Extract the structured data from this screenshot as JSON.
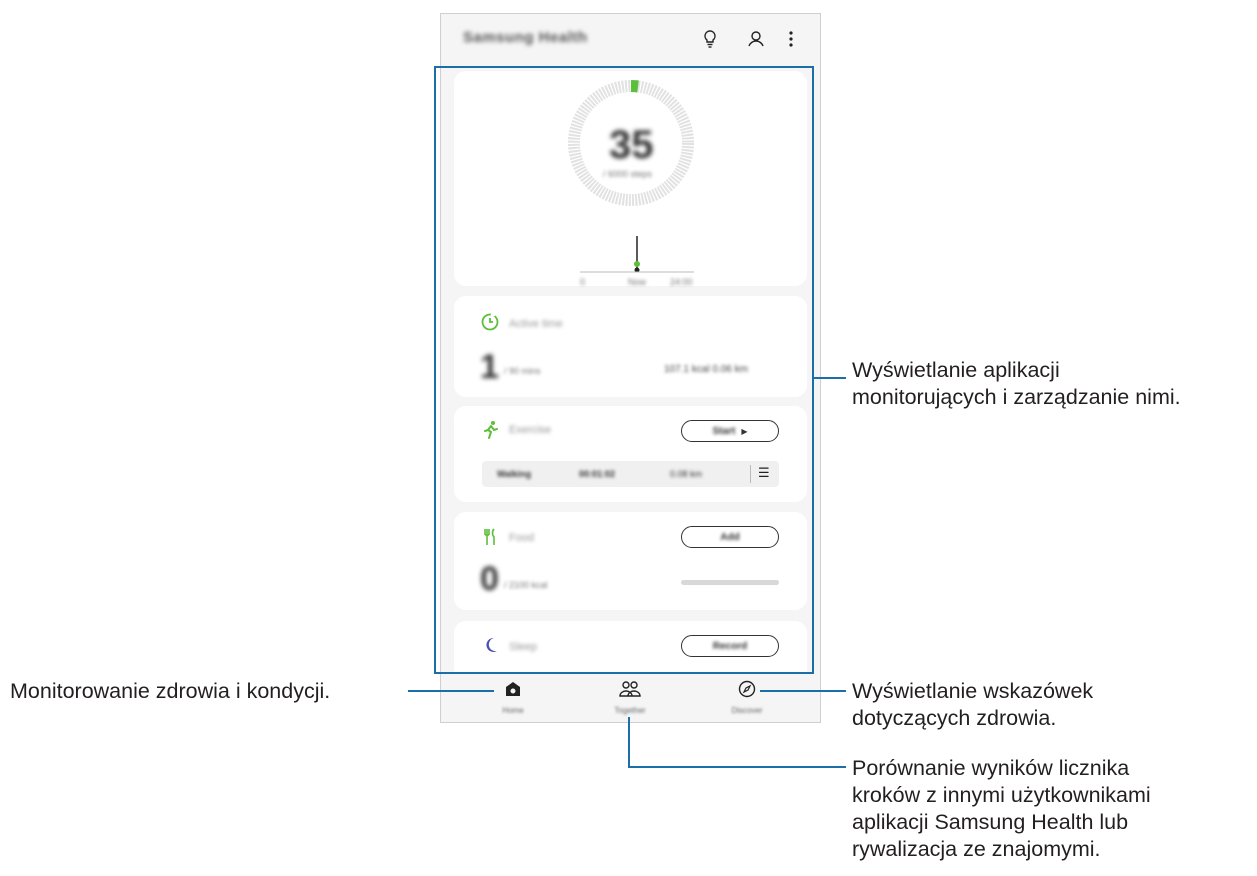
{
  "app": {
    "title": "Samsung Health",
    "icons": [
      "lightbulb-icon",
      "person-icon",
      "more-vertical-icon"
    ]
  },
  "steps_card": {
    "value": "35",
    "target": "/ 6000 steps",
    "chart_labels": [
      "0",
      "Now",
      "24:00"
    ]
  },
  "active_time_card": {
    "title": "Active time",
    "value": "1",
    "unit": "/ 90 mins",
    "detail": "107.1 kcal  0.06 km"
  },
  "exercise_card": {
    "title": "Exercise",
    "button": "Start",
    "last_activity": "Walking",
    "last_time": "00:01:02",
    "last_distance": "0.08 km"
  },
  "food_card": {
    "title": "Food",
    "button": "Add",
    "value": "0",
    "unit": "/ 2100 kcal"
  },
  "sleep_card": {
    "title": "Sleep",
    "button": "Record"
  },
  "nav": {
    "home": "Home",
    "together": "Together",
    "discover": "Discover"
  },
  "callouts": {
    "trackers": [
      "Wyświetlanie aplikacji",
      "monitorujących i zarządzanie nimi."
    ],
    "home": "Monitorowanie zdrowia i kondycji.",
    "discover": [
      "Wyświetlanie wskazówek",
      "dotyczących zdrowia."
    ],
    "together": [
      "Porównanie wyników licznika",
      "kroków z innymi użytkownikami",
      "aplikacji Samsung Health lub",
      "rywalizacja ze znajomymi."
    ]
  },
  "colors": {
    "accent_green": "#5cbf3a",
    "callout_line": "#1a6fa8",
    "sleep_moon": "#4b4fb5"
  }
}
